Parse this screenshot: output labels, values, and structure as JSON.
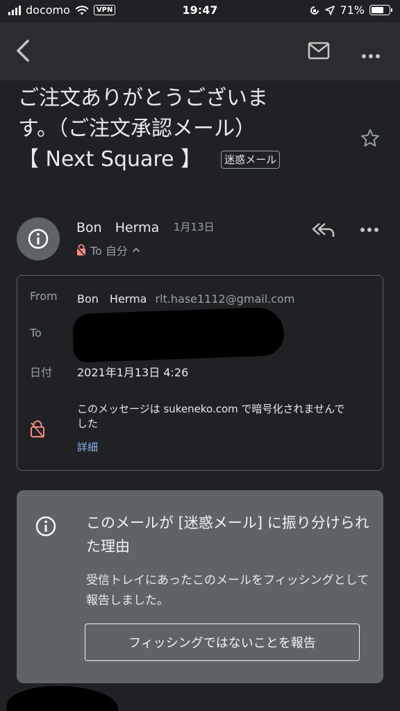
{
  "status_bar": {
    "carrier": "docomo",
    "vpn": "VPN",
    "time": "19:47",
    "battery": "71%",
    "battery_level": 0.71
  },
  "toolbar": {
    "back_icon": "chevron-left-icon",
    "mail_icon": "mail-icon",
    "more_icon": "more-horizontal-icon"
  },
  "email": {
    "subject_line1": "ご注文ありがとうございま",
    "subject_line2": "す。（ご注文承認メール）",
    "subject_line3": "【 Next Square 】",
    "spam_label": "迷惑メール",
    "sender_name": "Bon　Herma",
    "date": "1月13日",
    "recipient": "To 自分",
    "details": {
      "from_label": "From",
      "from_name": "Bon　Herma",
      "from_email": "rlt.hase1112@gmail.com",
      "to_label": "To",
      "date_label": "日付",
      "date_value": "2021年1月13日 4:26",
      "encryption_text": "このメッセージは sukeneko.com で暗号化されませんでした",
      "details_link": "詳細"
    }
  },
  "spam_card": {
    "title": "このメールが [迷惑メール] に振り分けられた理由",
    "body": "受信トレイにあったこのメールをフィッシングとして報告しました。",
    "button": "フィッシングではないことを報告"
  },
  "colors": {
    "background": "#202124",
    "toolbar": "#2b2c2f",
    "card": "#5f6368",
    "link": "#8ab4f8",
    "warning": "#f28b82"
  }
}
